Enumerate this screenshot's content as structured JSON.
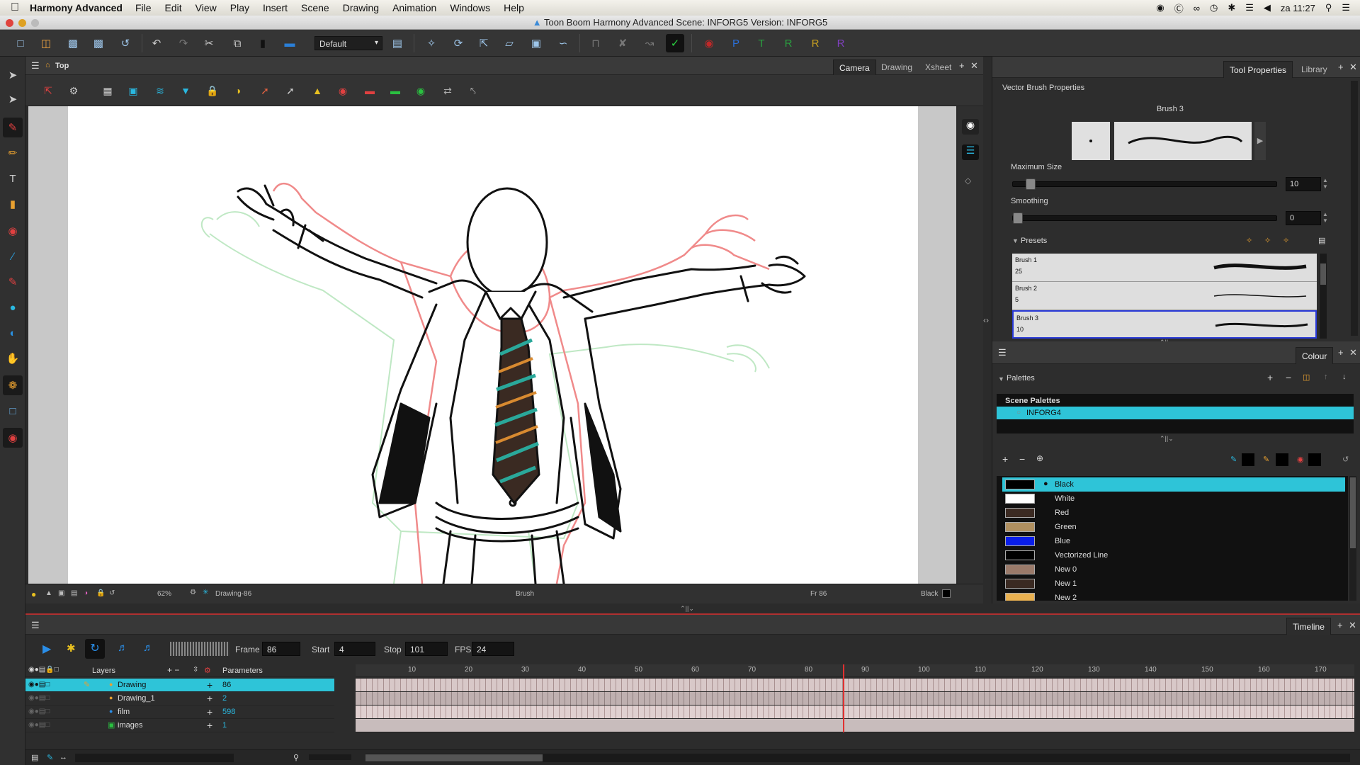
{
  "menubar": {
    "app_name": "Harmony Advanced",
    "items": [
      "File",
      "Edit",
      "View",
      "Play",
      "Insert",
      "Scene",
      "Drawing",
      "Animation",
      "Windows",
      "Help"
    ],
    "clock": "za 11:27"
  },
  "window": {
    "title": "Toon Boom Harmony Advanced Scene: INFORG5 Version: INFORG5"
  },
  "toolbar": {
    "workspace": "Default"
  },
  "camera_view": {
    "breadcrumb": "Top",
    "tabs": [
      "Camera",
      "Drawing",
      "Xsheet"
    ],
    "active_tab": "Camera",
    "status": {
      "zoom": "62%",
      "drawing": "Drawing-86",
      "tool": "Brush",
      "frame": "Fr 86",
      "colour": "Black"
    }
  },
  "tool_properties": {
    "tabs": [
      "Tool Properties",
      "Library"
    ],
    "section_title": "Vector Brush Properties",
    "brush_name": "Brush 3",
    "max_size_label": "Maximum Size",
    "max_size_value": "10",
    "max_size_level": 0.05,
    "smoothing_label": "Smoothing",
    "smoothing_value": "0",
    "smoothing_level": 0,
    "presets_label": "Presets",
    "presets": [
      {
        "name": "Brush 1",
        "size": "25"
      },
      {
        "name": "Brush 2",
        "size": "5"
      },
      {
        "name": "Brush 3",
        "size": "10"
      }
    ],
    "selected_preset": 2
  },
  "colour_panel": {
    "tab": "Colour",
    "palettes_label": "Palettes",
    "scene_palettes_label": "Scene Palettes",
    "palette_name": "INFORG4",
    "swatches": [
      {
        "name": "Black",
        "color": "#000000",
        "selected": true
      },
      {
        "name": "White",
        "color": "#ffffff"
      },
      {
        "name": "Red",
        "color": "#3b2a22"
      },
      {
        "name": "Green",
        "color": "#b09060"
      },
      {
        "name": "Blue",
        "color": "#0a1ee8"
      },
      {
        "name": "Vectorized Line",
        "color": "#000000"
      },
      {
        "name": "New 0",
        "color": "#9a7a6a"
      },
      {
        "name": "New 1",
        "color": "#3a2a22"
      },
      {
        "name": "New 2",
        "color": "#e8b050"
      }
    ]
  },
  "timeline": {
    "tab": "Timeline",
    "frame_label": "Frame",
    "frame_value": "86",
    "start_label": "Start",
    "start_value": "4",
    "stop_label": "Stop",
    "stop_value": "101",
    "fps_label": "FPS",
    "fps_value": "24",
    "layers_header": "Layers",
    "params_header": "Parameters",
    "layers": [
      {
        "name": "Drawing",
        "value": "86",
        "selected": true
      },
      {
        "name": "Drawing_1",
        "value": "2"
      },
      {
        "name": "film",
        "value": "598"
      },
      {
        "name": "images",
        "value": "1"
      }
    ],
    "ruler": [
      "10",
      "20",
      "30",
      "40",
      "50",
      "60",
      "70",
      "80",
      "90",
      "100",
      "110",
      "120",
      "130",
      "140",
      "150",
      "160",
      "170"
    ],
    "current_frame": 86
  },
  "colors": {
    "accent": "#2ec4d8",
    "selection": "#36b6cc",
    "playhead": "#e03030"
  }
}
